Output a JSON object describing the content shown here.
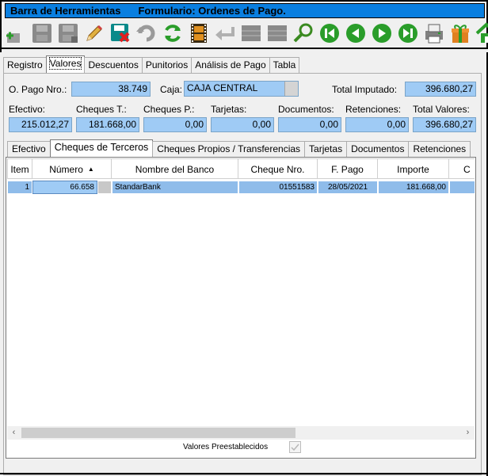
{
  "toolbar": {
    "title": "Barra de Herramientas",
    "subtitle": "Formulario: Ordenes de Pago.",
    "icons": [
      "add-icon",
      "save-icon",
      "save-as-icon",
      "edit-icon",
      "delete-icon",
      "undo-icon",
      "refresh-icon",
      "film-icon",
      "back-arrow-icon",
      "grid-icon",
      "grid2-icon",
      "search-icon",
      "first-record-icon",
      "previous-record-icon",
      "next-record-icon",
      "last-record-icon",
      "print-icon",
      "gift-icon",
      "home-icon"
    ]
  },
  "tabs": [
    "Registro",
    "Valores",
    "Descuentos",
    "Punitorios",
    "Análisis de Pago",
    "Tabla"
  ],
  "active_tab": "Valores",
  "header": {
    "pago_label": "O. Pago Nro.:",
    "pago_value": "38.749",
    "caja_label": "Caja:",
    "caja_value": "CAJA CENTRAL",
    "total_imputado_label": "Total Imputado:",
    "total_imputado_value": "396.680,27"
  },
  "totals": {
    "efectivo_label": "Efectivo:",
    "efectivo_value": "215.012,27",
    "cheques_t_label": "Cheques T.:",
    "cheques_t_value": "181.668,00",
    "cheques_p_label": "Cheques P.:",
    "cheques_p_value": "0,00",
    "tarjetas_label": "Tarjetas:",
    "tarjetas_value": "0,00",
    "documentos_label": "Documentos:",
    "documentos_value": "0,00",
    "retenciones_label": "Retenciones:",
    "retenciones_value": "0,00",
    "total_valores_label": "Total Valores:",
    "total_valores_value": "396.680,27"
  },
  "inner_tabs": [
    "Efectivo",
    "Cheques de Terceros",
    "Cheques Propios / Transferencias",
    "Tarjetas",
    "Documentos",
    "Retenciones"
  ],
  "active_inner_tab": "Cheques de Terceros",
  "grid": {
    "columns": [
      "Item",
      "Número",
      "Nombre del Banco",
      "Cheque Nro.",
      "F. Pago",
      "Importe",
      "C"
    ],
    "sort_indicator": "▲",
    "rows": [
      {
        "item": "1",
        "numero": "66.658",
        "banco": "StandarBank",
        "cheque": "01551583",
        "fecha": "28/05/2021",
        "importe": "181.668,00"
      }
    ]
  },
  "preset": {
    "label": "Valores Preestablecidos",
    "checked": true
  },
  "colors": {
    "titlebar": "#0a7fe0",
    "field_bg": "#9fcbf5",
    "row_bg": "#8fbcea"
  }
}
